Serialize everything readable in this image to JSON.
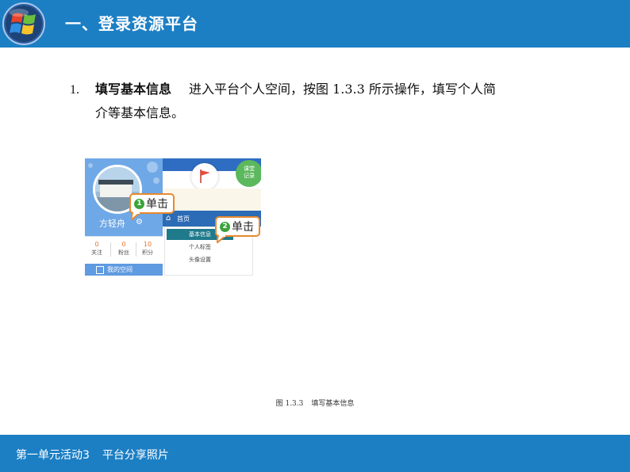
{
  "header": {
    "title": "一、登录资源平台"
  },
  "paragraph": {
    "number": "1.",
    "bold_label": "填写基本信息",
    "line1": "进入平台个人空间，按图 1.3.3 所示操作，填写个人简",
    "line2": "介等基本信息。"
  },
  "figure": {
    "username": "方轻舟",
    "stats": [
      {
        "value": "0",
        "label": "关注"
      },
      {
        "value": "0",
        "label": "粉丝"
      },
      {
        "value": "10",
        "label": "积分"
      }
    ],
    "bottom_label": "我的空间",
    "badge_text_line1": "课堂",
    "badge_text_line2": "记录",
    "nav_home": "首页",
    "dropdown_items": [
      "基本信息",
      "个人标签",
      "头像设置"
    ],
    "callout1": {
      "number": "1",
      "text": "单击"
    },
    "callout2": {
      "number": "2",
      "text": "单击"
    },
    "colors": {
      "accent_blue": "#1c7fc4",
      "callout_border": "#e8892f",
      "callout_badge": "#3aa33a",
      "active_item": "#1f7a8c"
    }
  },
  "caption": {
    "number": "图 1.3.3",
    "text": "填写基本信息"
  },
  "footer": {
    "unit": "第一单元活动3",
    "topic": "平台分享照片"
  }
}
